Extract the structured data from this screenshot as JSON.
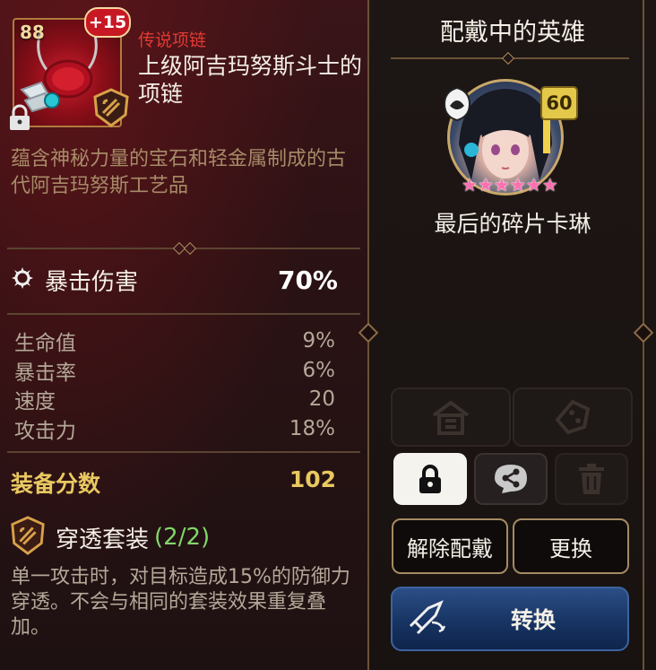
{
  "item": {
    "level": "88",
    "enhance": "+15",
    "type": "传说项链",
    "name": "上级阿吉玛努斯斗士的项链",
    "description": "蕴含神秘力量的宝石和轻金属制成的古代阿吉玛努斯工艺品"
  },
  "main_stat": {
    "label": "暴击伤害",
    "value": "70%"
  },
  "sub_stats": [
    {
      "label": "生命值",
      "value": "9%"
    },
    {
      "label": "暴击率",
      "value": "6%"
    },
    {
      "label": "速度",
      "value": "20"
    },
    {
      "label": "攻击力",
      "value": "18%"
    }
  ],
  "score": {
    "label": "装备分数",
    "value": "102"
  },
  "set": {
    "title": "穿透套装",
    "count": "(2/2)",
    "description": "单一攻击时，对目标造成15%的防御力穿透。不会与相同的套装效果重复叠加。"
  },
  "hero": {
    "panel_title": "配戴中的英雄",
    "name": "最后的碎片卡琳",
    "level": "60",
    "stars": 6
  },
  "buttons": {
    "unequip": "解除配戴",
    "change": "更换",
    "convert": "转换"
  },
  "colors": {
    "item_type": "#e03a36",
    "score": "#e9c860",
    "set_count": "#82d66a",
    "convert_button": "#1f3f75"
  }
}
